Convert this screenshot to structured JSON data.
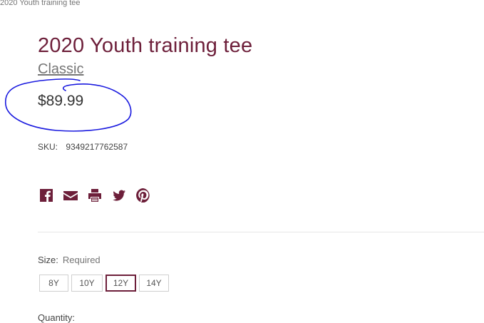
{
  "breadcrumb": "2020 Youth training tee",
  "product": {
    "title": "2020 Youth training tee",
    "brand": "Classic",
    "price": "$89.99",
    "sku_label": "SKU:",
    "sku_value": "9349217762587"
  },
  "share_icons": [
    "facebook-icon",
    "email-icon",
    "print-icon",
    "twitter-icon",
    "pinterest-icon"
  ],
  "size": {
    "label": "Size:",
    "required": "Required",
    "options": [
      "8Y",
      "10Y",
      "12Y",
      "14Y"
    ],
    "selected": "12Y"
  },
  "quantity": {
    "label": "Quantity:"
  },
  "colors": {
    "accent": "#6d1f3a",
    "annotation": "#1a1adf"
  }
}
